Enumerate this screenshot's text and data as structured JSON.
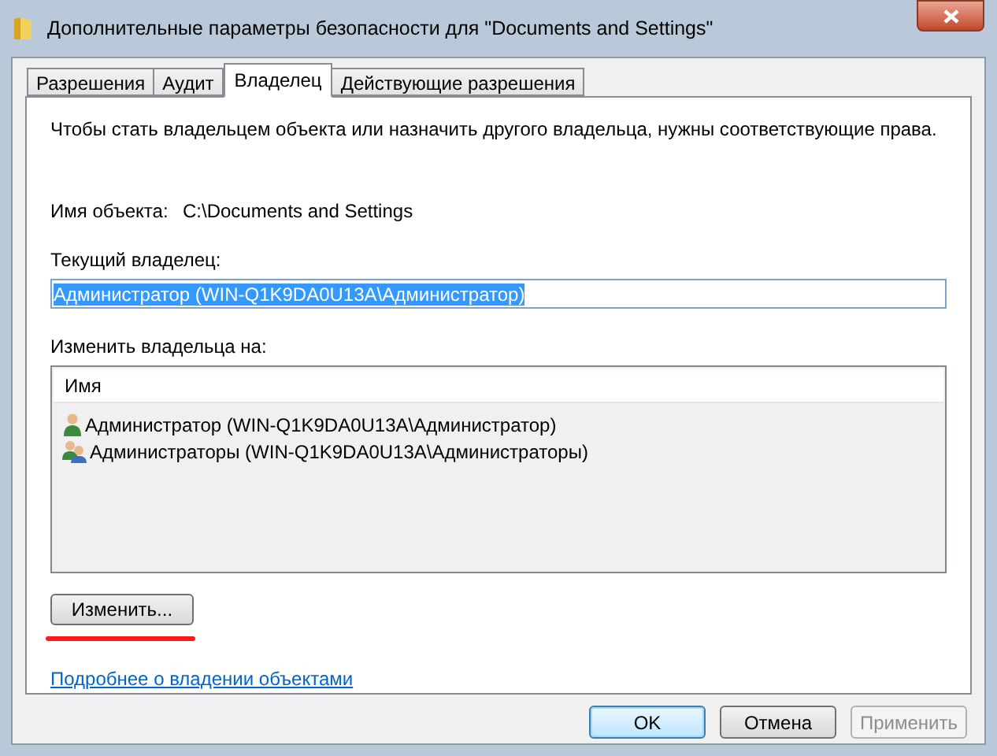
{
  "window": {
    "title": "Дополнительные параметры безопасности  для \"Documents and Settings\""
  },
  "tabs": [
    {
      "label": "Разрешения",
      "selected": false
    },
    {
      "label": "Аудит",
      "selected": false
    },
    {
      "label": "Владелец",
      "selected": true
    },
    {
      "label": "Действующие разрешения",
      "selected": false
    }
  ],
  "intro": "Чтобы стать владельцем объекта или назначить другого владельца, нужны соответствующие права.",
  "object_name": {
    "label": "Имя объекта:",
    "value": "C:\\Documents and Settings"
  },
  "current_owner": {
    "label": "Текущий владелец:",
    "value": "Администратор (WIN-Q1K9DA0U13A\\Администратор)"
  },
  "change_owner": {
    "label": "Изменить владельца на:",
    "column": "Имя",
    "rows": [
      {
        "kind": "user",
        "name": "Администратор (WIN-Q1K9DA0U13A\\Администратор)"
      },
      {
        "kind": "group",
        "name": "Администраторы (WIN-Q1K9DA0U13A\\Администраторы)"
      }
    ]
  },
  "change_button": "Изменить...",
  "link": "Подробнее о владении объектами",
  "buttons": [
    {
      "label": "OK",
      "kind": "default",
      "disabled": false
    },
    {
      "label": "Отмена",
      "kind": "normal",
      "disabled": false
    },
    {
      "label": "Применить",
      "kind": "normal",
      "disabled": true
    }
  ]
}
